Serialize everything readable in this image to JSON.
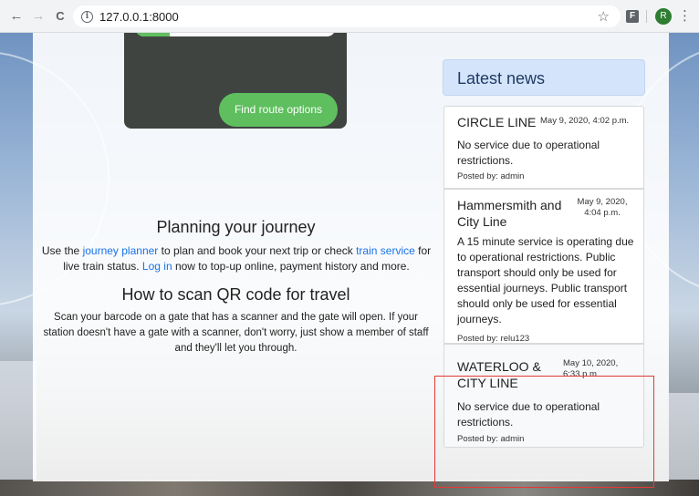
{
  "browser": {
    "back": "←",
    "forward": "→",
    "reload": "C",
    "url": "127.0.0.1:8000",
    "star": "☆",
    "extension": "F",
    "avatar_initial": "R",
    "menu": "⋮"
  },
  "route_card": {
    "button_label": "Find route options"
  },
  "planning": {
    "heading": "Planning your journey",
    "text_1": "Use the ",
    "link_planner": "journey planner",
    "text_2": " to plan and book your next trip or check ",
    "link_service": "train service",
    "text_3": " for live train status. ",
    "link_login": "Log in",
    "text_4": " now to top-up online, payment history and more."
  },
  "scan": {
    "heading": "How to scan QR code for travel",
    "text": "Scan your barcode on a gate that has a scanner and the gate will open. If your station doesn't have a gate with a scanner, don't worry, just show a member of staff and they'll let you through."
  },
  "news": {
    "header": "Latest news",
    "items": [
      {
        "title": "CIRCLE LINE",
        "date": "May 9, 2020, 4:02 p.m.",
        "body": "No service due to operational restrictions.",
        "posted_by": "Posted by: admin"
      },
      {
        "title": "Hammersmith and City Line",
        "date": "May 9, 2020, 4:04 p.m.",
        "body": "A 15 minute service is operating due to operational restrictions. Public transport should only be used for essential journeys. Public transport should only be used for essential journeys.",
        "posted_by": "Posted by: relu123"
      },
      {
        "title": "WATERLOO & CITY LINE",
        "date": "May 10, 2020, 6:33 p.m.",
        "body": "No service due to operational restrictions.",
        "posted_by": "Posted by: admin"
      }
    ]
  },
  "colors": {
    "accent_green": "#5fbf5e",
    "link_blue": "#1a73e8",
    "news_header_bg": "#d4e4fa",
    "highlight_red": "#e53935"
  }
}
